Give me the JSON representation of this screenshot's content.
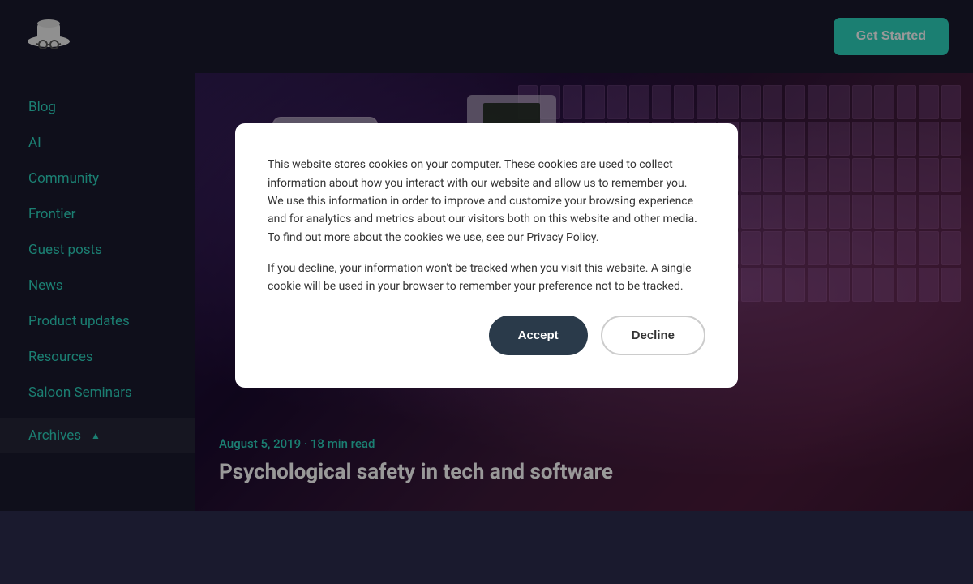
{
  "header": {
    "logo_alt": "Hat with glasses logo",
    "get_started_label": "Get Started"
  },
  "sidebar": {
    "items": [
      {
        "label": "Blog",
        "id": "blog"
      },
      {
        "label": "AI",
        "id": "ai"
      },
      {
        "label": "Community",
        "id": "community"
      },
      {
        "label": "Frontier",
        "id": "frontier"
      },
      {
        "label": "Guest posts",
        "id": "guest-posts"
      },
      {
        "label": "News",
        "id": "news"
      },
      {
        "label": "Product updates",
        "id": "product-updates"
      },
      {
        "label": "Resources",
        "id": "resources"
      },
      {
        "label": "Saloon Seminars",
        "id": "saloon-seminars"
      },
      {
        "label": "Archives",
        "id": "archives"
      }
    ]
  },
  "article": {
    "date": "August 5, 2019 · 18 min read",
    "title": "Psychological safety in tech and software"
  },
  "cookie_modal": {
    "paragraph1": "This website stores cookies on your computer. These cookies are used to collect information about how you interact with our website and allow us to remember you. We use this information in order to improve and customize your browsing experience and for analytics and metrics about our visitors both on this website and other media. To find out more about the cookies we use, see our Privacy Policy.",
    "paragraph2": "If you decline, your information won't be tracked when you visit this website. A single cookie will be used in your browser to remember your preference not to be tracked.",
    "accept_label": "Accept",
    "decline_label": "Decline"
  }
}
